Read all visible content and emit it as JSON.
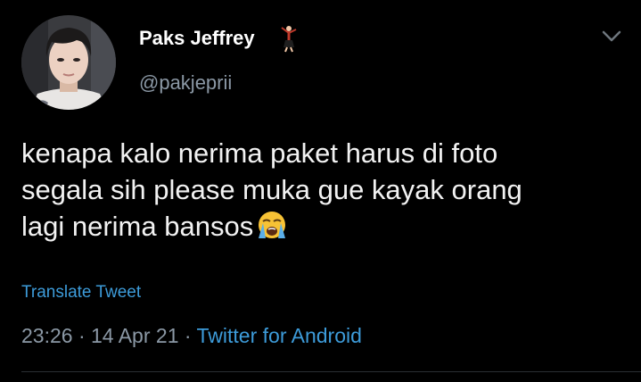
{
  "tweet": {
    "author": {
      "display_name": "Paks Jeffrey",
      "name_emoji": "dancer-emoji",
      "handle": "@pakjeprii"
    },
    "text_lines": [
      "kenapa kalo nerima paket harus di foto",
      "segala sih please muka gue kayak orang",
      "lagi nerima bansos"
    ],
    "text_emoji": "loudly-crying-face-emoji",
    "translate_label": "Translate Tweet",
    "time": "23:26",
    "separator": "·",
    "date": "14 Apr 21",
    "source": "Twitter for Android"
  },
  "colors": {
    "background": "#000000",
    "text": "#f2f2f2",
    "secondary": "#8b98a5",
    "link": "#3d9bd9",
    "divider": "#2a2f33"
  }
}
